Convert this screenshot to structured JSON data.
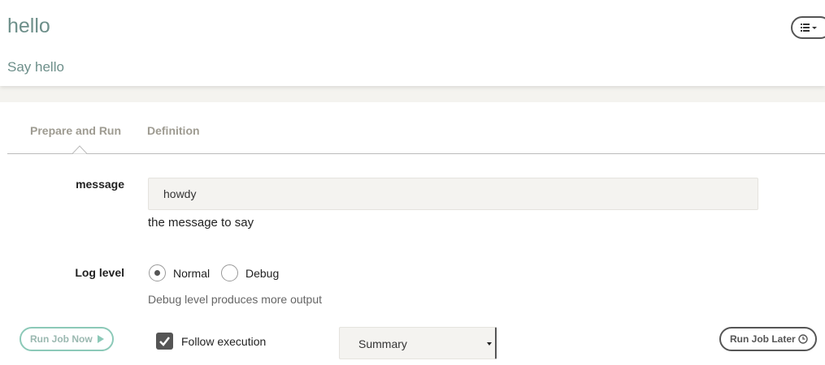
{
  "job": {
    "title": "hello",
    "description": "Say hello"
  },
  "header": {
    "menu_icon": "list-menu-icon"
  },
  "tabs": [
    {
      "label": "Prepare and Run",
      "active": true
    },
    {
      "label": "Definition",
      "active": false
    }
  ],
  "options": {
    "message": {
      "label": "message",
      "value": "howdy",
      "help": "the message to say"
    },
    "log_level": {
      "label": "Log level",
      "choices": [
        {
          "label": "Normal",
          "selected": true
        },
        {
          "label": "Debug",
          "selected": false
        }
      ],
      "help": "Debug level produces more output"
    }
  },
  "actions": {
    "run_now_label": "Run Job Now",
    "run_now_icon": "play-icon",
    "follow_execution_label": "Follow execution",
    "follow_execution_checked": true,
    "follow_mode": "Summary",
    "run_later_label": "Run Job Later",
    "run_later_icon": "clock-icon"
  },
  "colors": {
    "accent": "#8cc9b8",
    "title": "#6d8f8a",
    "tab_text": "#9e9b91",
    "input_bg": "#f4f3f0"
  }
}
